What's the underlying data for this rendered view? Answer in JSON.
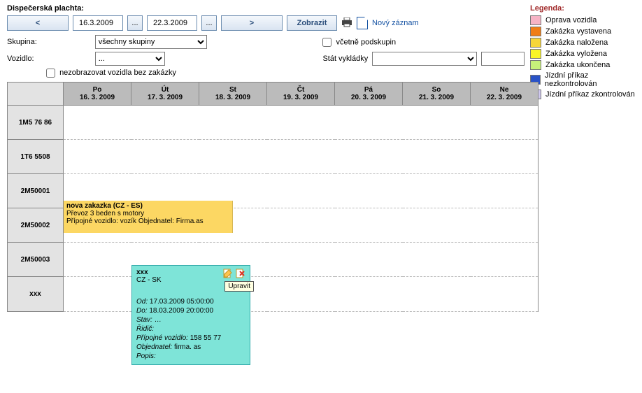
{
  "title": "Dispečerská plachta:",
  "nav": {
    "prev": "<",
    "next": ">",
    "date_from": "16.3.2009",
    "date_to": "22.3.2009",
    "dots": "...",
    "show": "Zobrazit"
  },
  "toolbar": {
    "print_icon": "print-icon",
    "new_icon": "new-document-icon",
    "new_link": "Nový záznam"
  },
  "filters": {
    "group_label": "Skupina:",
    "group_value": "všechny skupiny",
    "incl_sub_label": "včetně podskupin",
    "incl_sub_checked": false,
    "vehicle_label": "Vozidlo:",
    "vehicle_value": "...",
    "state_label": "Stát vykládky",
    "state_value": "",
    "hide_empty_label": "nezobrazovat vozidla bez zakázky",
    "hide_empty_checked": false
  },
  "legend": {
    "title": "Legenda:",
    "items": [
      {
        "label": "Oprava vozidla",
        "color": "#f6b3c5"
      },
      {
        "label": "Zakázka vystavena",
        "color": "#f07d16"
      },
      {
        "label": "Zakázka naložena",
        "color": "#f6d63a"
      },
      {
        "label": "Zakázka vyložena",
        "color": "#f9f527"
      },
      {
        "label": "Zakázka ukončena",
        "color": "#c7f07a"
      },
      {
        "label": "Jízdní příkaz nezkontrolován",
        "color": "#2a53c7"
      },
      {
        "label": "Jízdní příkaz zkontrolován",
        "color": "#cfc8ee"
      }
    ]
  },
  "grid": {
    "days": [
      {
        "dow": "Po",
        "date": "16. 3. 2009"
      },
      {
        "dow": "Út",
        "date": "17. 3. 2009"
      },
      {
        "dow": "St",
        "date": "18. 3. 2009"
      },
      {
        "dow": "Čt",
        "date": "19. 3. 2009"
      },
      {
        "dow": "Pá",
        "date": "20. 3. 2009"
      },
      {
        "dow": "So",
        "date": "21. 3. 2009"
      },
      {
        "dow": "Ne",
        "date": "22. 3. 2009"
      }
    ],
    "rows": [
      "1M5 76 86",
      "1T6 5508",
      "2M50001",
      "2M50002",
      "2M50003",
      "xxx"
    ]
  },
  "order_card": {
    "title": "nova zakazka (CZ - ES)",
    "line2": "Převoz 3 beden s motory",
    "line3": "Přípojné vozidlo: vozík Objednatel: Firma.as"
  },
  "popup": {
    "title": "xxx",
    "subtitle": "CZ - SK",
    "tooltip": "Upravit",
    "od_label": "Od:",
    "od": "17.03.2009 05:00:00",
    "do_label": "Do:",
    "do": "18.03.2009 20:00:00",
    "stav_label": "Stav:",
    "stav": "…",
    "ridic_label": "Řidič:",
    "pripoj_label": "Přípojné vozidlo:",
    "pripoj": "158 55 77",
    "objed_label": "Objednatel:",
    "objed": "firma. as",
    "popis_label": "Popis:"
  }
}
